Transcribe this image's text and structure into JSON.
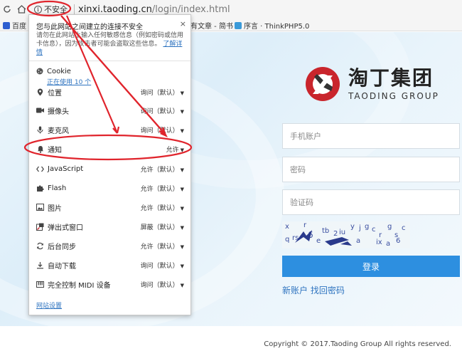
{
  "browser": {
    "security_label": "不安全",
    "url_host": "xinxi.taoding.cn",
    "url_path": "/login/index.html"
  },
  "bookmarks": [
    {
      "label": "百度"
    },
    {
      "label": "有文章 - 简书"
    },
    {
      "label": "序言 · ThinkPHP5.0"
    }
  ],
  "popup": {
    "title": "您与此网站之间建立的连接不安全",
    "description": "请勿在此网站上输入任何敏感信息（例如密码或信用卡信息），因为攻击者可能会盗取这些信息。",
    "learn_more": "了解详情",
    "close": "×",
    "cookie_label": "Cookie",
    "cookie_usage": "正在使用 10 个",
    "permissions": [
      {
        "label": "位置",
        "value": "询问（默认）",
        "icon": "location-icon"
      },
      {
        "label": "摄像头",
        "value": "询问（默认）",
        "icon": "camera-icon"
      },
      {
        "label": "麦克风",
        "value": "询问（默认）",
        "icon": "microphone-icon"
      },
      {
        "label": "通知",
        "value": "允许",
        "icon": "bell-icon"
      },
      {
        "label": "JavaScript",
        "value": "允许（默认）",
        "icon": "code-icon"
      },
      {
        "label": "Flash",
        "value": "允许（默认）",
        "icon": "puzzle-icon"
      },
      {
        "label": "图片",
        "value": "允许（默认）",
        "icon": "image-icon"
      },
      {
        "label": "弹出式窗口",
        "value": "屏蔽（默认）",
        "icon": "popup-icon"
      },
      {
        "label": "后台同步",
        "value": "允许（默认）",
        "icon": "sync-icon"
      },
      {
        "label": "自动下载",
        "value": "询问（默认）",
        "icon": "download-icon"
      },
      {
        "label": "完全控制 MIDI 设备",
        "value": "询问（默认）",
        "icon": "midi-icon"
      }
    ],
    "site_settings": "网站设置"
  },
  "brand": {
    "name_cn": "淘丁集团",
    "name_en": "TAODING GROUP",
    "color": "#c9252c"
  },
  "login": {
    "phone_placeholder": "手机账户",
    "password_placeholder": "密码",
    "captcha_placeholder": "验证码",
    "submit_label": "登录",
    "register_link": "新账户",
    "forgot_link": "找回密码",
    "button_color": "#2d8fe0"
  },
  "footer": {
    "copyright": "Copyright © 2017.Taoding Group All rights reserved."
  },
  "annotation_color": "#e0242c"
}
